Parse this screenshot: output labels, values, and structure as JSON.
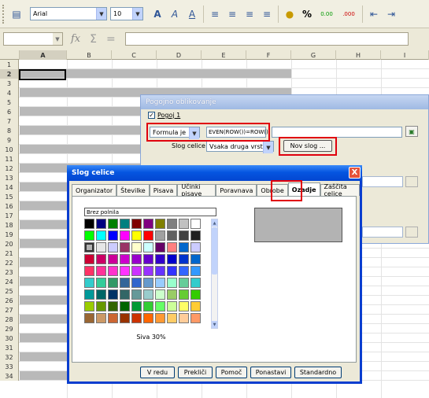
{
  "toolbar": {
    "font_name": "Arial",
    "font_size": "10",
    "bold_icon": "A",
    "italic_icon": "A",
    "underline_icon": "A",
    "percent_label": "%",
    "add_decimal_label": "0.00",
    "del_decimal_label": ".000"
  },
  "formula_bar": {
    "fx": "fx",
    "sigma": "Σ",
    "equals": "="
  },
  "sheet": {
    "columns": [
      "A",
      "B",
      "C",
      "D",
      "E",
      "F",
      "G",
      "H",
      "I"
    ],
    "rows": [
      "1",
      "2",
      "3",
      "4",
      "5",
      "6",
      "7",
      "8",
      "9",
      "10",
      "11",
      "12",
      "13",
      "14",
      "15",
      "16",
      "17",
      "18",
      "19",
      "20",
      "21",
      "22",
      "23",
      "24",
      "25",
      "26",
      "27",
      "28",
      "29",
      "30",
      "31",
      "32",
      "33",
      "34"
    ]
  },
  "cond_dialog": {
    "title": "Pogojno oblikovanje",
    "condition_label": "Pogoj 1",
    "condition_type": "Formula je",
    "formula": "EVEN(ROW())=ROW()",
    "cell_style_label": "Slog celice",
    "cell_style_value": "Vsaka druga vrsta",
    "new_style_button": "Nov slog ..."
  },
  "cell_dialog": {
    "title": "Slog celice",
    "close": "X",
    "tabs": [
      "Organizator",
      "Številke",
      "Pisava",
      "Učinki pisave",
      "Poravnava",
      "Obrobe",
      "Ozadje",
      "Zaščita celice"
    ],
    "no_fill": "Brez polnila",
    "selected_color": "Siva 30%",
    "buttons": {
      "ok": "V redu",
      "cancel": "Prekliči",
      "help": "Pomoč",
      "reset": "Ponastavi",
      "standard": "Standardno"
    },
    "palette": [
      "#000000",
      "#000080",
      "#008000",
      "#008080",
      "#800000",
      "#800080",
      "#808000",
      "#808080",
      "#c0c0c0",
      "#ffffff",
      "#00ff00",
      "#00ffff",
      "#0000ff",
      "#ff00ff",
      "#ffff00",
      "#ff0000",
      "#a0a0a0",
      "#606060",
      "#404040",
      "#202020",
      "#b3b3b3",
      "#e6e6e6",
      "#ccccff",
      "#993366",
      "#ffffcc",
      "#ccffff",
      "#660066",
      "#ff8080",
      "#0066cc",
      "#ccccff",
      "#cc0033",
      "#cc0066",
      "#cc0099",
      "#cc00cc",
      "#9900cc",
      "#6600cc",
      "#3300cc",
      "#0000cc",
      "#0033cc",
      "#0066cc",
      "#ff3366",
      "#ff3399",
      "#ff33cc",
      "#ff33ff",
      "#cc33ff",
      "#9933ff",
      "#6633ff",
      "#3333ff",
      "#3366ff",
      "#3399ff",
      "#33cccc",
      "#33cc99",
      "#339966",
      "#336699",
      "#3366cc",
      "#6699cc",
      "#99ccff",
      "#99ffcc",
      "#66cc99",
      "#33cccc",
      "#009999",
      "#006666",
      "#003366",
      "#336666",
      "#669999",
      "#99cccc",
      "#ccffcc",
      "#99cc66",
      "#66cc33",
      "#33cc00",
      "#99cc00",
      "#669900",
      "#336600",
      "#006600",
      "#009933",
      "#33cc33",
      "#66ff66",
      "#ccff99",
      "#ffff66",
      "#ffcc33",
      "#996633",
      "#cc9966",
      "#cc6633",
      "#993300",
      "#cc3300",
      "#ff6600",
      "#ff9933",
      "#ffcc66",
      "#ffcc99",
      "#ff9966",
      "#ff6633",
      "#cc3333",
      "#990033",
      "#660033",
      "#330033",
      "#663366",
      "#996699",
      "#cc99cc",
      "#ffccff",
      "#ff99cc",
      "#ccff33",
      "#cc9900",
      "#ff6633",
      "#ff3300",
      "#ffff99",
      "#ffcc00",
      "#00cc99",
      "#3366cc",
      "#99ccff",
      "#ff66cc"
    ]
  }
}
